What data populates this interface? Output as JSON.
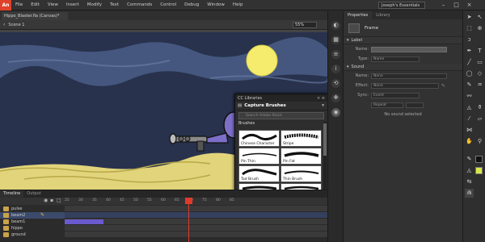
{
  "menu": {
    "logo": "An",
    "items": [
      "File",
      "Edit",
      "View",
      "Insert",
      "Modify",
      "Text",
      "Commands",
      "Control",
      "Debug",
      "Window",
      "Help"
    ],
    "workspace": "Joseph's Essentials"
  },
  "document": {
    "tab": "Hippo_Blaster.fla (Canvas)*",
    "scene": "Scene 1",
    "zoom": "55%"
  },
  "properties": {
    "tabs": [
      "Properties",
      "Library"
    ],
    "frame_label": "Frame",
    "label_section": "Label",
    "name_label": "Name:",
    "type_label": "Type:",
    "type_value": "Name",
    "sound_section": "Sound",
    "sound_name_label": "Name:",
    "sound_name_value": "None",
    "effect_label": "Effect:",
    "effect_value": "None",
    "sync_label": "Sync:",
    "sync_value": "Event",
    "repeat_value": "Repeat",
    "no_sound": "No sound selected"
  },
  "timeline": {
    "tabs": [
      "Timeline",
      "Output"
    ],
    "ticks": [
      "25",
      "30",
      "35",
      "40",
      "45",
      "50",
      "55",
      "60",
      "65",
      "70",
      "75",
      "80",
      "85"
    ],
    "layers": [
      "pulse",
      "beam2",
      "beam1",
      "hippo",
      "ground"
    ]
  },
  "cc_libraries": {
    "title": "CC Libraries",
    "library": "Capture Brushes",
    "search_placeholder": "Search Adobe Stock",
    "section": "Brushes",
    "brushes": [
      "Chinese Character",
      "Stripe",
      "Pin Thin",
      "Pin Fat",
      "Tad Brush",
      "Thin Brush"
    ]
  }
}
